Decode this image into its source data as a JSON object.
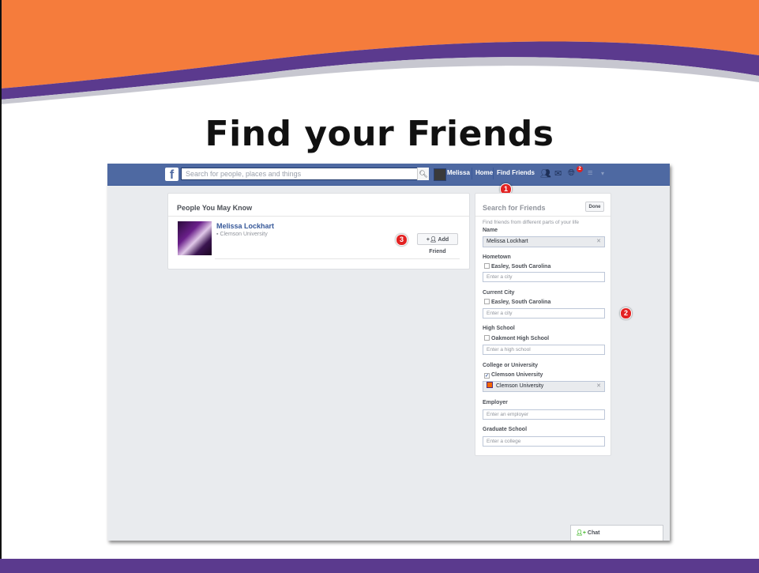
{
  "slide": {
    "title": "Find your Friends",
    "colors": {
      "orange": "#f57c3c",
      "purple": "#5b3a8e",
      "fb_blue": "#4e69a2"
    }
  },
  "topbar": {
    "logo": "f",
    "search_placeholder": "Search for people, places and things",
    "search_icon": "search-icon",
    "user_name": "Melissa",
    "home_label": "Home",
    "find_friends_label": "Find Friends",
    "notifications_count": "2"
  },
  "pymk": {
    "title": "People You May Know",
    "person": {
      "name": "Melissa Lockhart",
      "school": "Clemson University",
      "add_friend_label": "Add Friend"
    }
  },
  "callouts": {
    "one": "1",
    "two": "2",
    "three": "3"
  },
  "search_friends": {
    "title": "Search for Friends",
    "done_label": "Done",
    "subtitle": "Find friends from different parts of your life",
    "name": {
      "label": "Name",
      "value": "Melissa Lockhart"
    },
    "hometown": {
      "label": "Hometown",
      "option": "Easley, South Carolina",
      "placeholder": "Enter a city"
    },
    "current_city": {
      "label": "Current City",
      "option": "Easley, South Carolina",
      "placeholder": "Enter a city"
    },
    "high_school": {
      "label": "High School",
      "option": "Oakmont High School",
      "placeholder": "Enter a high school"
    },
    "college": {
      "label": "College or University",
      "option": "Clemson University",
      "value": "Clemson University"
    },
    "employer": {
      "label": "Employer",
      "placeholder": "Enter an employer"
    },
    "grad_school": {
      "label": "Graduate School",
      "placeholder": "Enter a college"
    }
  },
  "chat": {
    "label": "Chat"
  }
}
